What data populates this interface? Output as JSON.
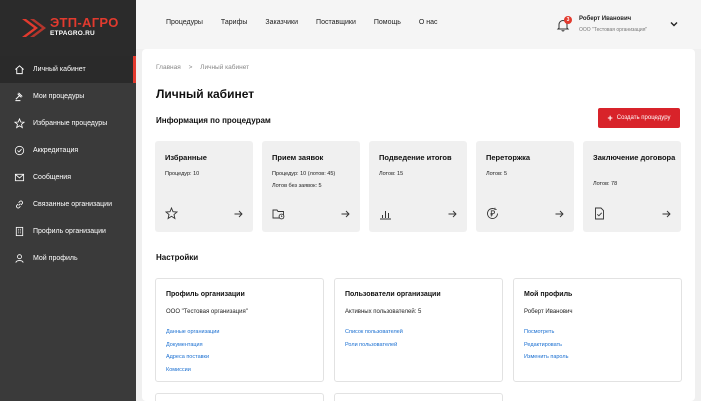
{
  "brand": {
    "title": "ЭТП-АГРО",
    "subtitle": "ETPAGRO.RU",
    "accent": "#e23a2e"
  },
  "sidebar": {
    "items": [
      {
        "label": "Личный кабинет",
        "icon": "home-icon",
        "active": true
      },
      {
        "label": "Мои процедуры",
        "icon": "gavel-icon"
      },
      {
        "label": "Избранные процедуры",
        "icon": "star-icon"
      },
      {
        "label": "Аккредитация",
        "icon": "check-circle-icon"
      },
      {
        "label": "Сообщения",
        "icon": "envelope-icon"
      },
      {
        "label": "Связанные организации",
        "icon": "link-icon"
      },
      {
        "label": "Профиль организации",
        "icon": "building-icon"
      },
      {
        "label": "Мой профиль",
        "icon": "user-icon"
      }
    ]
  },
  "header": {
    "nav": [
      "Процедуры",
      "Тарифы",
      "Заказчики",
      "Поставщики",
      "Помощь",
      "О нас"
    ],
    "notifications_count": "3",
    "user_name": "Роберт Иванович",
    "user_org": "ООО \"Тестовая организация\""
  },
  "breadcrumb": [
    "Главная",
    "Личный кабинет"
  ],
  "breadcrumb_separator": ">",
  "page_title": "Личный кабинет",
  "procedures": {
    "section_title": "Информация по процедурам",
    "create_button": "Создать процедуру",
    "cards": [
      {
        "title": "Избранные",
        "lines": [
          "Процедур: 10"
        ],
        "icon": "star-icon"
      },
      {
        "title": "Прием заявок",
        "lines": [
          "Процедур: 10 (лотов: 45)",
          "Лотов без заявок: 5"
        ],
        "icon": "folder-clock-icon"
      },
      {
        "title": "Подведение итогов",
        "lines": [
          "Лотов: 15"
        ],
        "icon": "bar-chart-icon"
      },
      {
        "title": "Переторжка",
        "lines": [
          "Лотов: 5"
        ],
        "icon": "ruble-refresh-icon"
      },
      {
        "title": "Заключение договора",
        "lines": [
          "Лотов: 78"
        ],
        "icon": "document-check-icon"
      }
    ]
  },
  "settings": {
    "section_title": "Настройки",
    "boxes": [
      {
        "title": "Профиль организации",
        "value": "ООО \"Тестовая организация\"",
        "links": [
          "Данные организации",
          "Документация",
          "Адреса поставки",
          "Комиссии"
        ]
      },
      {
        "title": "Пользователи организации",
        "value": "Активных пользователей: 5",
        "links": [
          "Список пользователей",
          "Роли пользователей"
        ]
      },
      {
        "title": "Мой профиль",
        "value": "Роберт Иванович",
        "links": [
          "Посмотреть",
          "Редактировать",
          "Изменить пароль"
        ]
      }
    ]
  }
}
